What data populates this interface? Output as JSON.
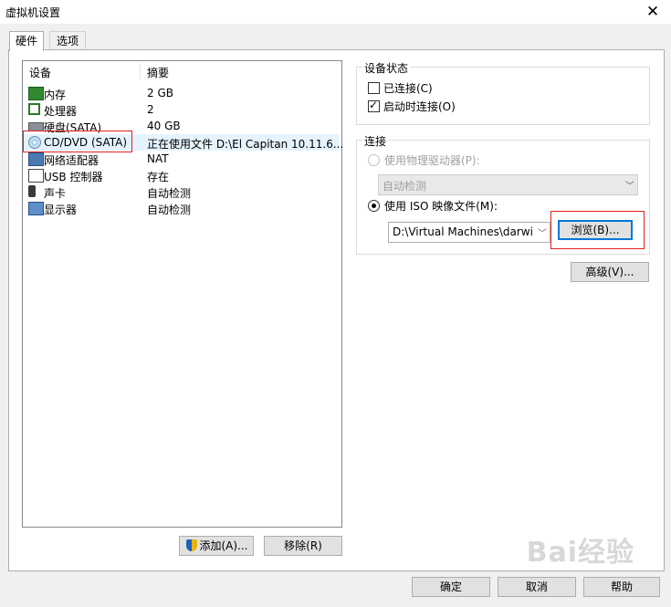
{
  "window": {
    "title": "虚拟机设置",
    "close_glyph": "✕"
  },
  "tabs": [
    {
      "label": "硬件",
      "active": true
    },
    {
      "label": "选项",
      "active": false
    }
  ],
  "device_list": {
    "headers": {
      "device": "设备",
      "summary": "摘要"
    },
    "rows": [
      {
        "name": "内存",
        "summary": "2 GB",
        "icon": "memory-icon"
      },
      {
        "name": "处理器",
        "summary": "2",
        "icon": "cpu-icon"
      },
      {
        "name": "硬盘(SATA)",
        "summary": "40 GB",
        "icon": "hard-disk-icon"
      },
      {
        "name": "CD/DVD (SATA)",
        "summary": "正在使用文件 D:\\El Capitan 10.11.6...",
        "icon": "cd-dvd-icon",
        "selected": true
      },
      {
        "name": "网络适配器",
        "summary": "NAT",
        "icon": "network-adapter-icon"
      },
      {
        "name": "USB 控制器",
        "summary": "存在",
        "icon": "usb-icon"
      },
      {
        "name": "声卡",
        "summary": "自动检测",
        "icon": "sound-card-icon"
      },
      {
        "name": "显示器",
        "summary": "自动检测",
        "icon": "display-icon"
      }
    ]
  },
  "buttons": {
    "add": "添加(A)...",
    "remove": "移除(R)",
    "ok": "确定",
    "cancel": "取消",
    "help": "帮助",
    "browse": "浏览(B)...",
    "advanced": "高级(V)..."
  },
  "device_status": {
    "label": "设备状态",
    "connected": {
      "label": "已连接(C)",
      "checked": false
    },
    "connect_at_power_on": {
      "label": "启动时连接(O)",
      "checked": true
    }
  },
  "connection": {
    "label": "连接",
    "physical_drive": {
      "label": "使用物理驱动器(P):",
      "selected": false,
      "enabled": false
    },
    "physical_drive_value": "自动检测",
    "iso": {
      "label": "使用 ISO 映像文件(M):",
      "selected": true
    },
    "iso_path": "D:\\Virtual Machines\\darwin_"
  },
  "watermark": "Bai经验",
  "colors": {
    "highlight": "#e02020",
    "selection": "#e5f3ff",
    "focus": "#0078d7"
  }
}
